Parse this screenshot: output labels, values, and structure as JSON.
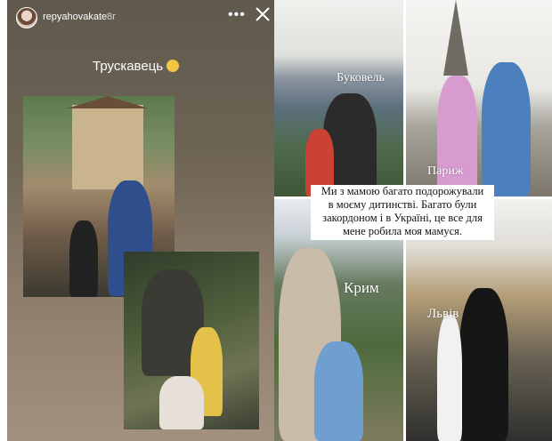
{
  "story": {
    "username": "repyahovakate",
    "time": "8г",
    "caption": "Трускавець",
    "caption_emoji": "grimacing-face-emoji"
  },
  "cities": {
    "bukovel": "Буковель",
    "paris": "Париж",
    "crimea": "Крим",
    "lviv": "Львів"
  },
  "textbox": {
    "lines": [
      "Ми з мамою багато подорожували",
      "в моєму дитинстві. Багато були",
      "закордоном і в Україні, це все для",
      "мене робила моя мамуся."
    ]
  },
  "colors": {
    "story_bg_top": "#5f5a4d",
    "story_bg_bottom": "#a3917f"
  }
}
